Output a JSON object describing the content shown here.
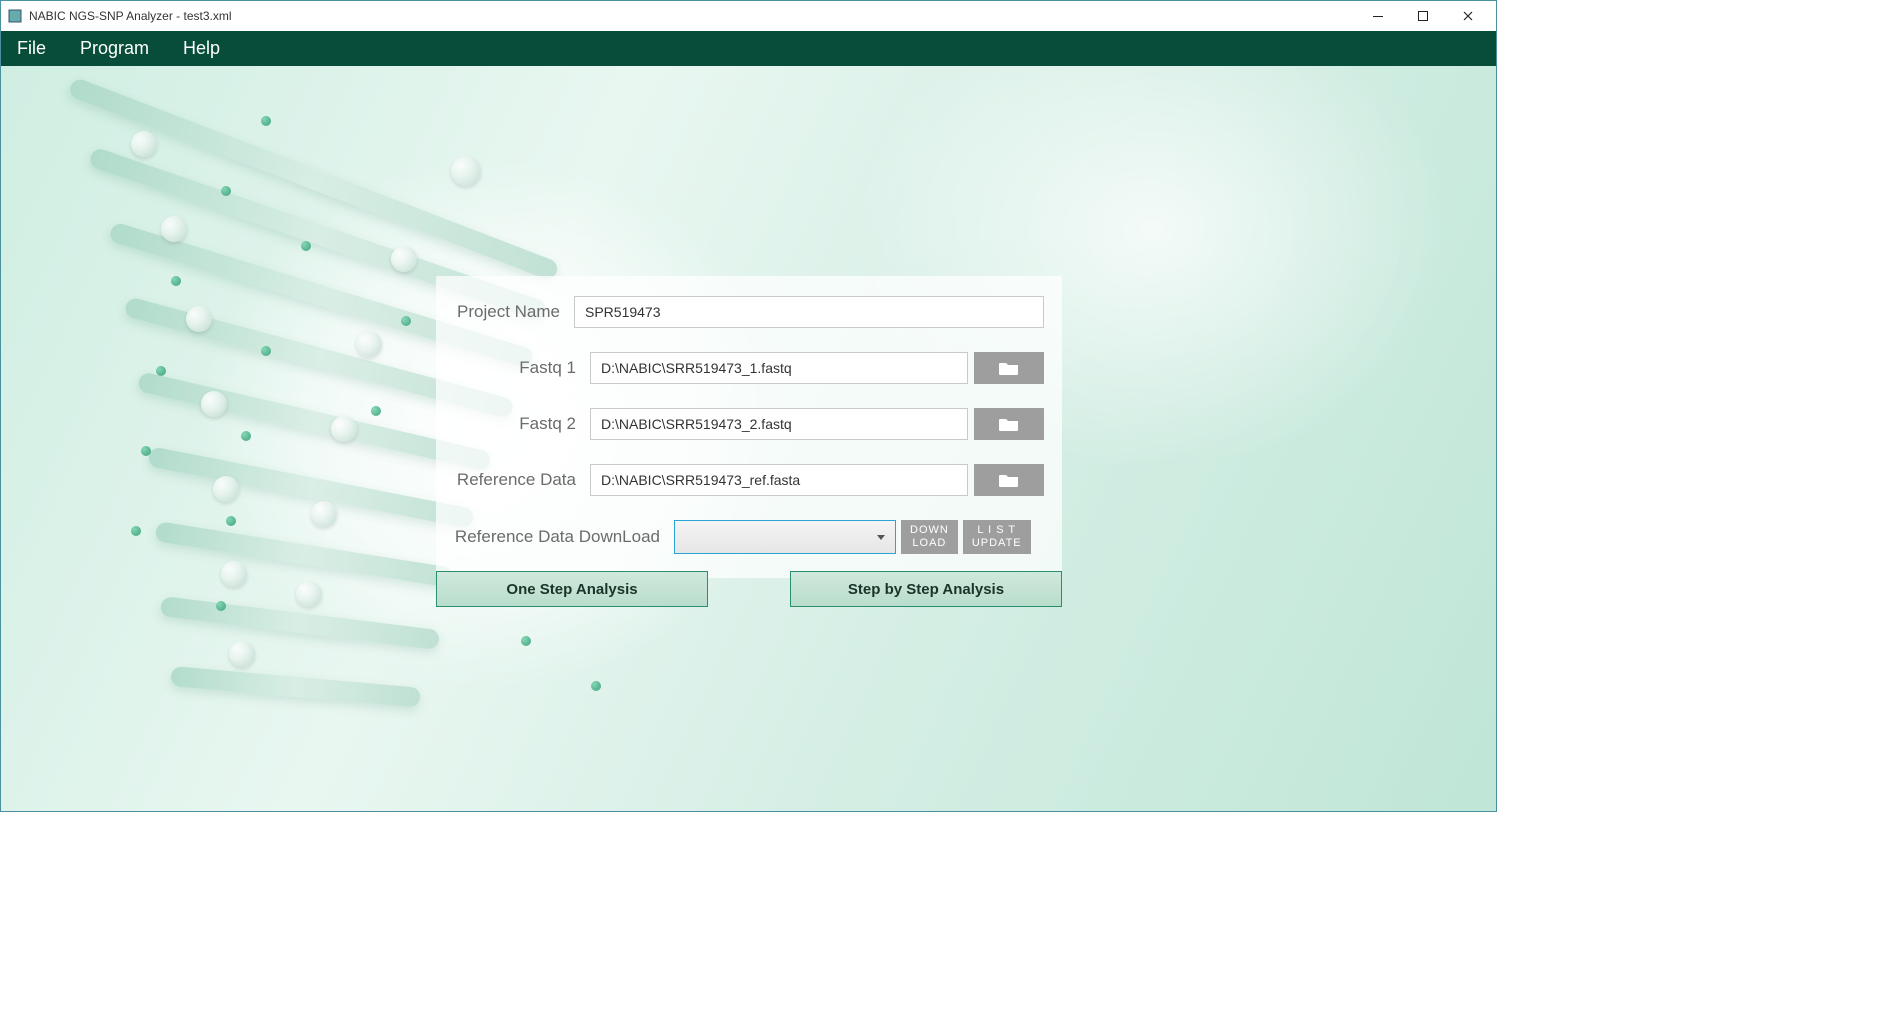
{
  "window": {
    "title": "NABIC NGS-SNP Analyzer - test3.xml"
  },
  "menu": {
    "file": "File",
    "program": "Program",
    "help": "Help"
  },
  "form": {
    "project_label": "Project Name",
    "project_value": "SPR519473",
    "fastq1_label": "Fastq 1",
    "fastq1_value": "D:\\NABIC\\SRR519473_1.fastq",
    "fastq2_label": "Fastq 2",
    "fastq2_value": "D:\\NABIC\\SRR519473_2.fastq",
    "ref_label": "Reference Data",
    "ref_value": "D:\\NABIC\\SRR519473_ref.fasta",
    "ref_dl_label": "Reference Data DownLoad",
    "ref_dl_value": "",
    "download_btn": "DOWN\nLOAD",
    "list_update_btn": "L I S T\nUPDATE"
  },
  "actions": {
    "one_step": "One Step Analysis",
    "step_by_step": "Step by Step Analysis"
  }
}
